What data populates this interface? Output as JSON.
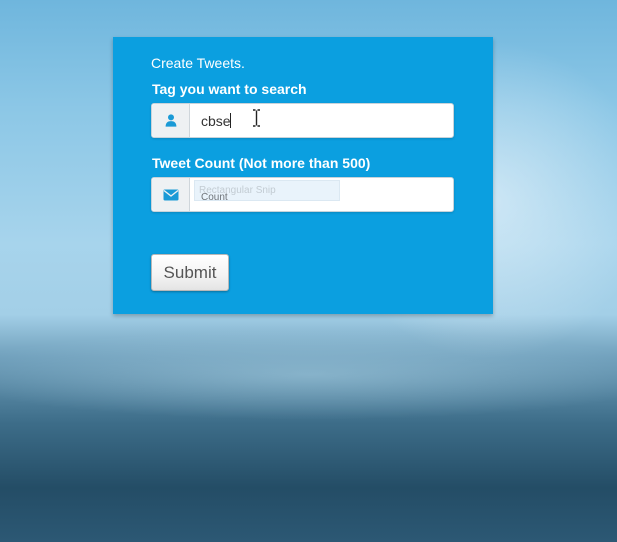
{
  "form": {
    "title": "Create Tweets.",
    "tag_label": "Tag you want to search",
    "tag_value": "cbse",
    "tag_icon": "user-icon",
    "count_label": "Tweet Count (Not more than 500)",
    "count_placeholder": "Count",
    "count_icon": "envelope-icon",
    "submit_label": "Submit"
  },
  "overlay": {
    "snip_text": "Rectangular Snip"
  },
  "colors": {
    "panel": "#0b9fe0",
    "icon": "#1a9ad6",
    "addon_bg": "#eef1f3"
  }
}
